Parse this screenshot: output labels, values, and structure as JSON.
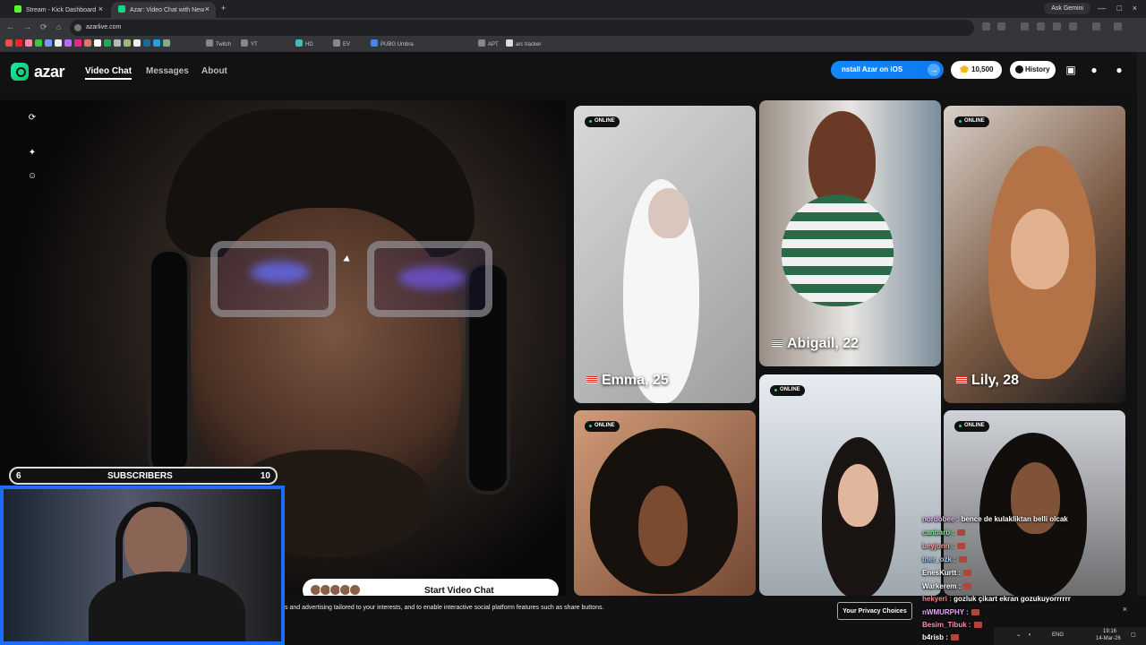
{
  "browser": {
    "tabs": [
      {
        "label": "Stream - Kick Dashboard",
        "color": "#52ff29"
      },
      {
        "label": "Azar: Video Chat with New",
        "color": "#18d686"
      }
    ],
    "ask_gemini": "Ask Gemini",
    "url": "azarlive.com",
    "bookmarks": [
      "Twitch",
      "YT",
      "HD",
      "EV",
      "PUBG Umbra",
      "APT",
      "arc tracker"
    ]
  },
  "header": {
    "brand": "azar",
    "nav": [
      "Video Chat",
      "Messages",
      "About"
    ],
    "install_ios": "nstall Azar on iOS",
    "coins": "10,500",
    "history": "History"
  },
  "cards": [
    {
      "status": "ONLINE",
      "name": "Emma, 25"
    },
    {
      "name": "Abigail, 22"
    },
    {
      "status": "ONLINE",
      "name": "Lily, 28"
    },
    {
      "status": "ONLINE"
    },
    {
      "status": "ONLINE"
    },
    {
      "status": "ONLINE"
    }
  ],
  "subscribers": {
    "left": "6",
    "label": "SUBSCRIBERS",
    "right": "10"
  },
  "start_chat": "Start Video Chat",
  "cookie": {
    "text": "s and advertising tailored to your interests, and to enable interactive social platform features such as share buttons.",
    "button": "Your Privacy Choices",
    "close": "×"
  },
  "chat": [
    {
      "user": "nordobee :",
      "message": "bence de kulakliktan belli olcak"
    },
    {
      "user": "canbarb :",
      "message": ""
    },
    {
      "user": "Leyjonn :",
      "message": ""
    },
    {
      "user": "tner_ozk :",
      "message": ""
    },
    {
      "user": "EnesKurtt :",
      "message": ""
    },
    {
      "user": "Warkerem :",
      "message": ""
    },
    {
      "user": "hekyeri :",
      "message": "gozluk çikart ekran gozukuyorrrrrr"
    },
    {
      "user": "nWMURPHY :",
      "message": ""
    },
    {
      "user": "Besim_Tibuk :",
      "message": ""
    },
    {
      "user": "b4risb :",
      "message": ""
    }
  ],
  "tray": {
    "lang": "ENG",
    "time": "19:16",
    "date": "14-Mar-26"
  }
}
